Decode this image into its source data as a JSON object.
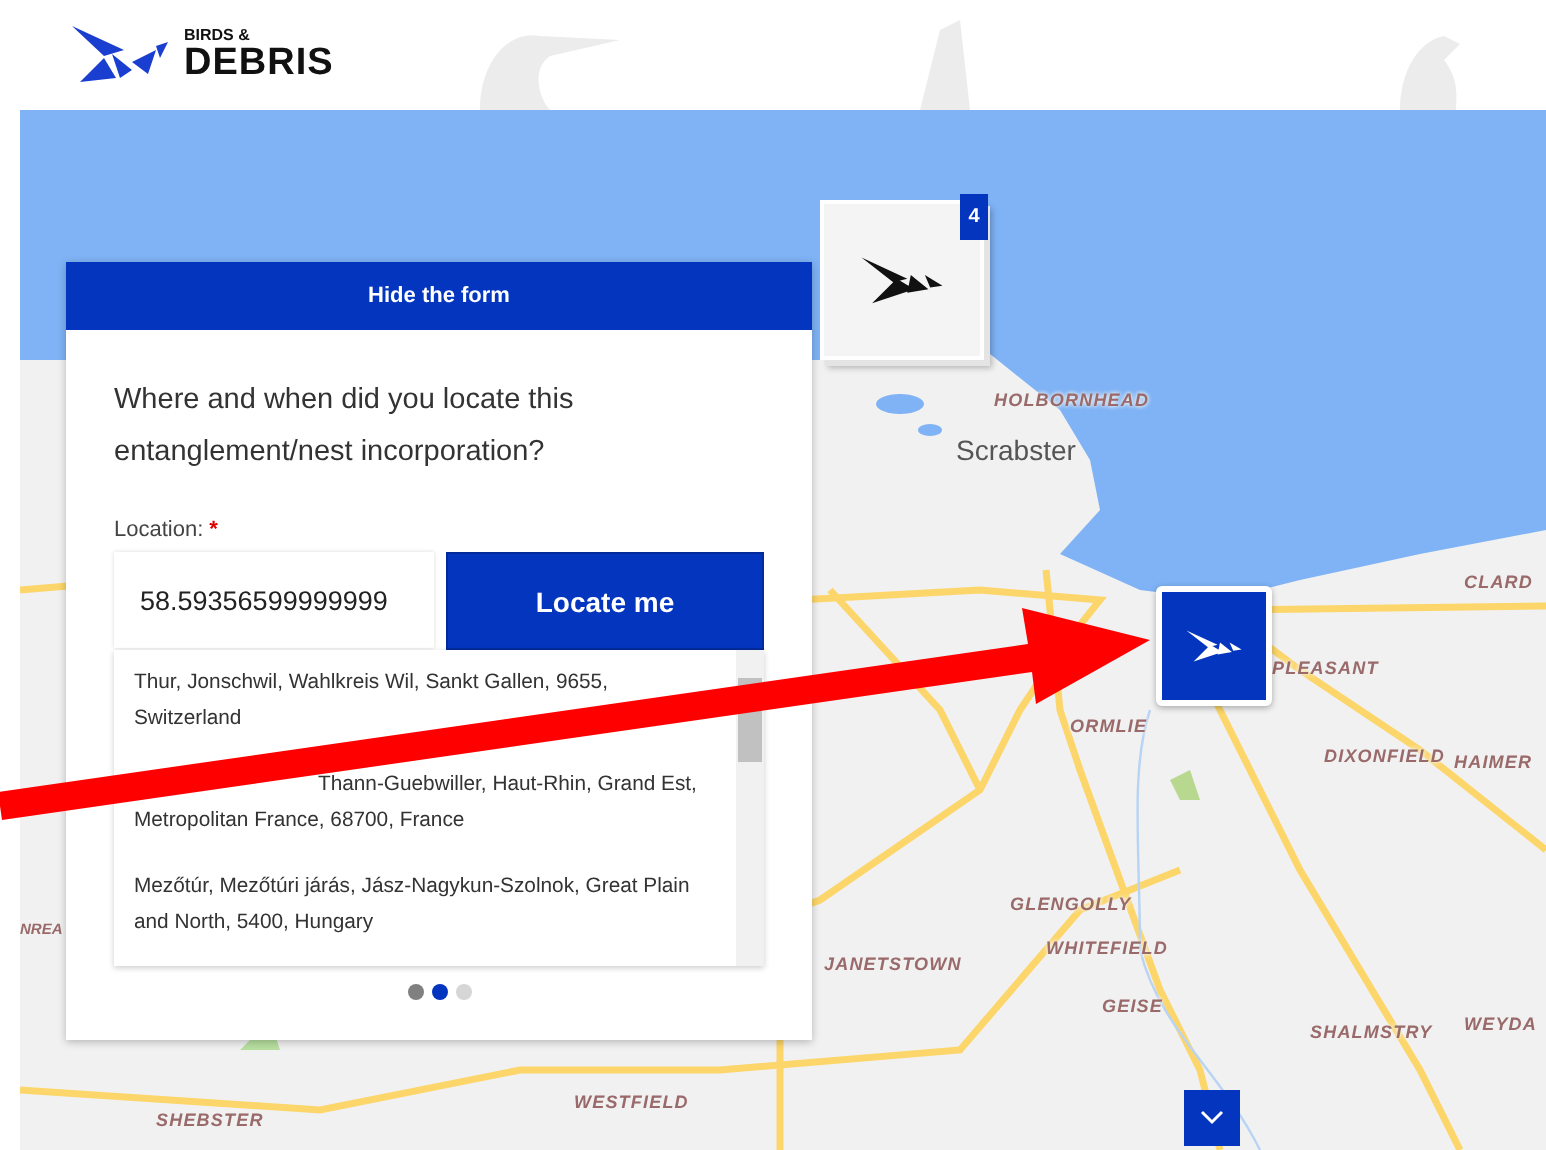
{
  "header": {
    "logo_top": "BIRDS &",
    "logo_bottom": "DEBRIS"
  },
  "form": {
    "toggle": "Hide the form",
    "question": "Where and when did you locate this entanglement/nest incorporation?",
    "location_label": "Location:",
    "required_mark": "*",
    "location_value": "58.59356599999999",
    "locate_button": "Locate me",
    "suggestions": [
      {
        "kind": "plain",
        "text": "Thur, Jonschwil, Wahlkreis Wil, Sankt Gallen, 9655, Switzerland"
      },
      {
        "kind": "covered",
        "text": "Thann-Guebwiller, Haut-Rhin, Grand Est, Metropolitan France, 68700, France"
      },
      {
        "kind": "plain",
        "text": "Mezőtúr, Mezőtúri járás, Jász-Nagykun-Szolnok, Great Plain and North, 5400, Hungary"
      }
    ],
    "pager": [
      {
        "selected": false
      },
      {
        "selected": true
      },
      {
        "selected": false
      }
    ]
  },
  "map": {
    "labels": [
      {
        "kind": "place",
        "text": "HOLBORNHEAD"
      },
      {
        "kind": "town",
        "text": "Scrabster"
      },
      {
        "kind": "place",
        "text": "CLARD"
      },
      {
        "kind": "place",
        "text": "PLEASANT"
      },
      {
        "kind": "place",
        "text": "ORMLIE"
      },
      {
        "kind": "place",
        "text": "DIXONFIELD"
      },
      {
        "kind": "place",
        "text": "HAIMER"
      },
      {
        "kind": "place",
        "text": "GLENGOLLY"
      },
      {
        "kind": "place",
        "text": "WHITEFIELD"
      },
      {
        "kind": "place",
        "text": "JANETSTOWN"
      },
      {
        "kind": "place",
        "text": "GEISE"
      },
      {
        "kind": "place",
        "text": "SHALMSTRY"
      },
      {
        "kind": "place",
        "text": "WEYDA"
      },
      {
        "kind": "place",
        "text": "NREA"
      },
      {
        "kind": "place",
        "text": "SHEBSTER"
      },
      {
        "kind": "place",
        "text": "WESTFIELD"
      }
    ],
    "cluster_count": "4"
  }
}
